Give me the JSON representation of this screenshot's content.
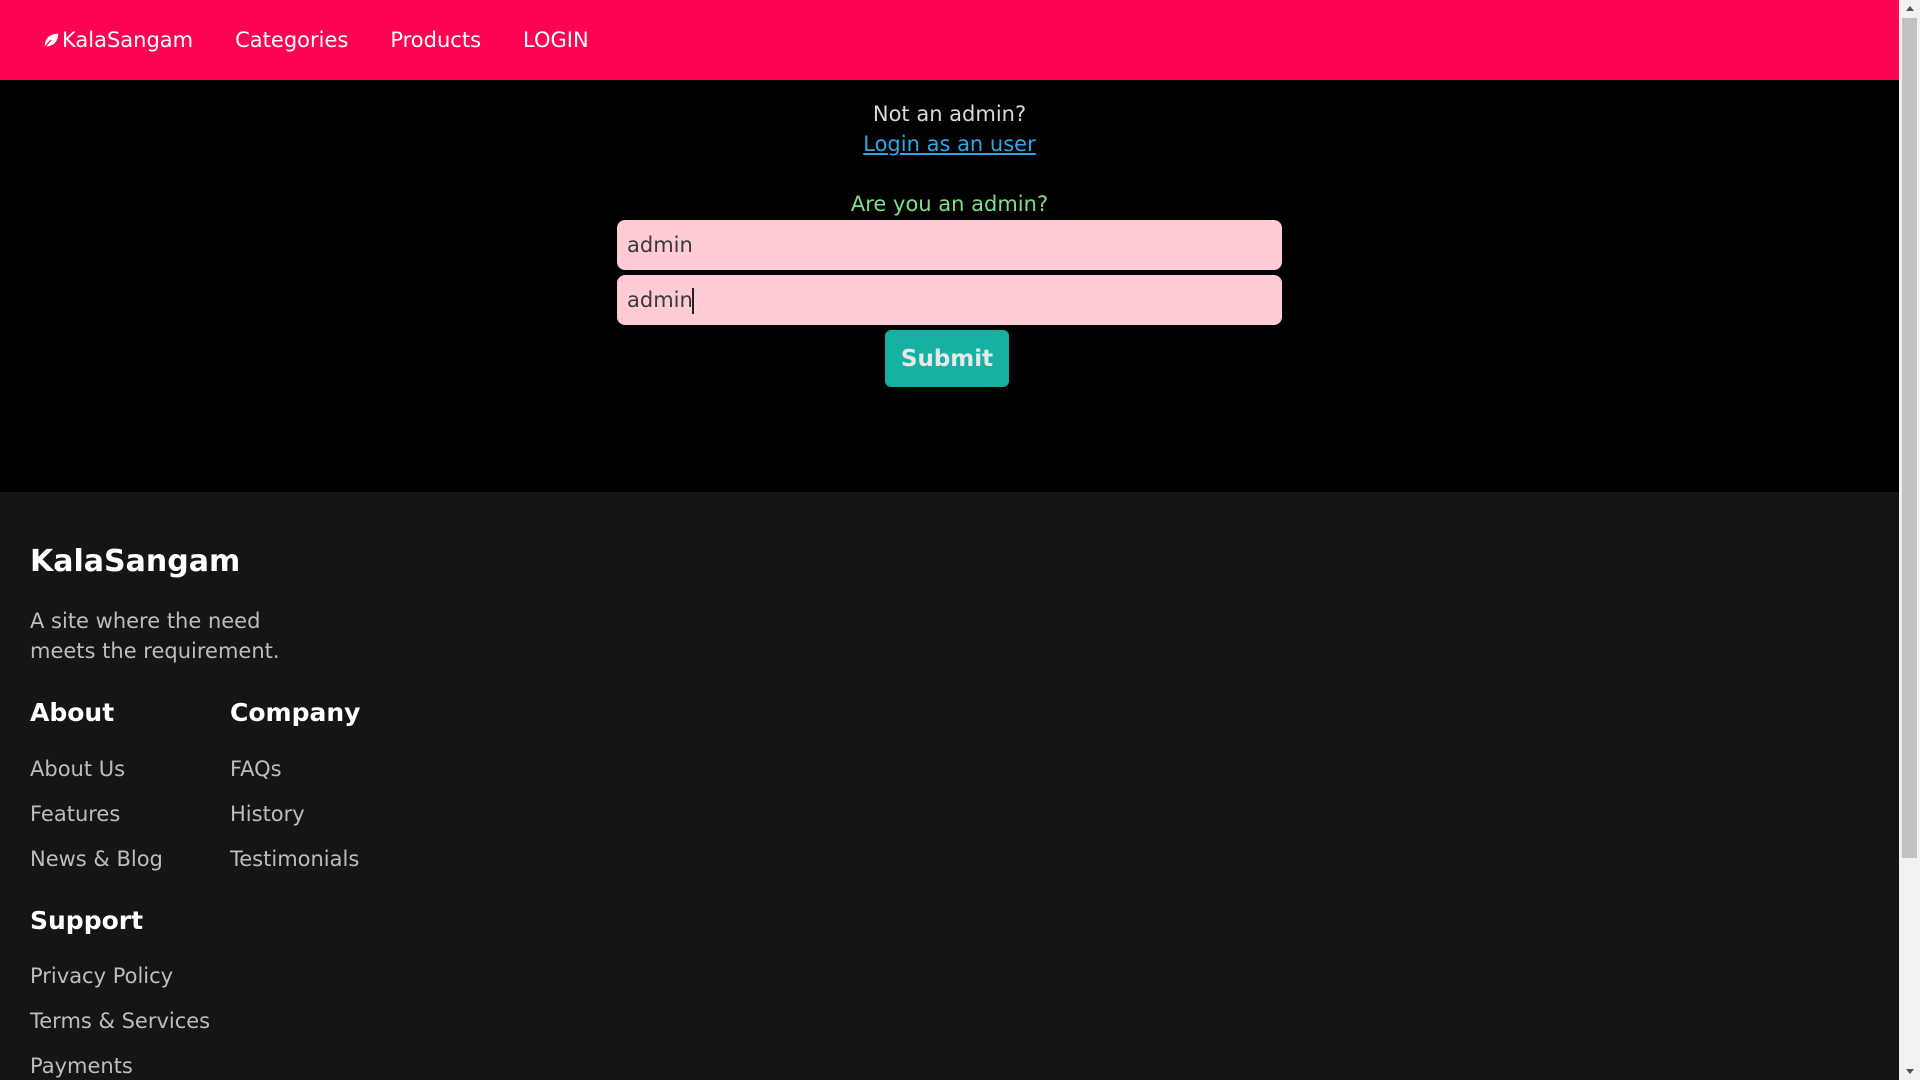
{
  "navbar": {
    "brand": "KalaSangam",
    "brand_icon": "leaf-icon",
    "links": [
      "Categories",
      "Products",
      "LOGIN"
    ],
    "bg_color": "#ff0254"
  },
  "main": {
    "not_admin_text": "Not an admin?",
    "login_user_link": "Login as an user",
    "admin_question": "Are you an admin?",
    "username_value": "admin",
    "password_value": "admin",
    "submit_label": "Submit",
    "submit_color": "#16b1a3",
    "field_color": "#ffccd5"
  },
  "footer": {
    "brand": "KalaSangam",
    "tagline": "A site where the need meets the requirement.",
    "about": {
      "heading": "About",
      "links": [
        "About Us",
        "Features",
        "News & Blog"
      ]
    },
    "company": {
      "heading": "Company",
      "links": [
        "FAQs",
        "History",
        "Testimonials"
      ]
    },
    "support": {
      "heading": "Support",
      "links": [
        "Privacy Policy",
        "Terms & Services",
        "Payments"
      ]
    }
  }
}
